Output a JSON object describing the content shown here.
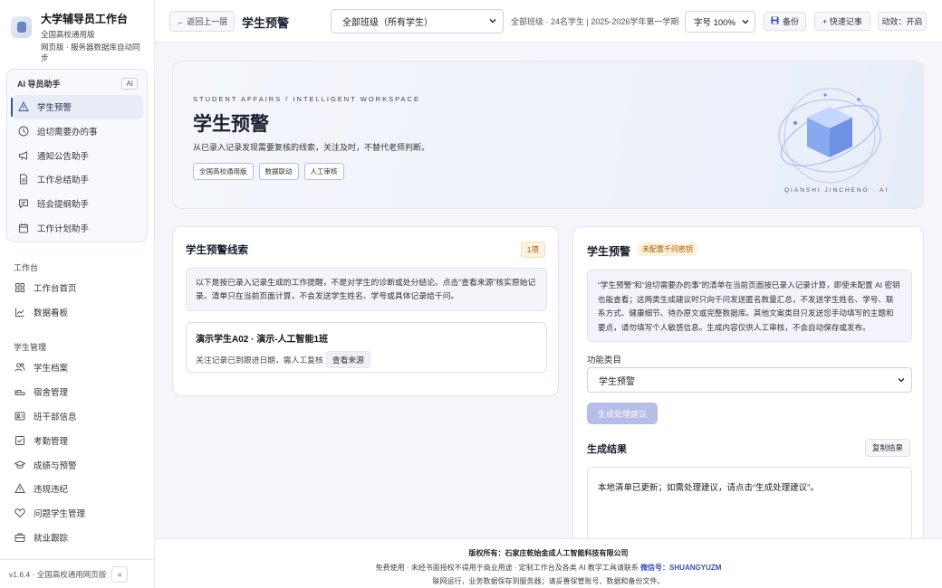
{
  "brand": {
    "title": "大学辅导员工作台",
    "line1": "全国高校通用版",
    "line2": "网页版 · 服务器数据库自动同步"
  },
  "ai_section": {
    "label": "AI 导员助手",
    "badge": "AI",
    "items": [
      {
        "label": "学生预警",
        "icon": "warning-triangle-icon",
        "active": true
      },
      {
        "label": "迫切需要办的事",
        "icon": "clock-icon"
      },
      {
        "label": "通知公告助手",
        "icon": "megaphone-icon"
      },
      {
        "label": "工作总结助手",
        "icon": "document-icon"
      },
      {
        "label": "班会提纲助手",
        "icon": "chat-icon"
      },
      {
        "label": "工作计划助手",
        "icon": "calendar-icon"
      }
    ]
  },
  "workbench_section": {
    "label": "工作台",
    "items": [
      {
        "label": "工作台首页",
        "icon": "grid-icon"
      },
      {
        "label": "数据看板",
        "icon": "line-chart-icon"
      }
    ]
  },
  "student_section": {
    "label": "学生管理",
    "items": [
      {
        "label": "学生档案",
        "icon": "users-icon"
      },
      {
        "label": "宿舍管理",
        "icon": "bed-icon"
      },
      {
        "label": "班干部信息",
        "icon": "id-card-icon"
      },
      {
        "label": "考勤管理",
        "icon": "checkbox-icon"
      },
      {
        "label": "成绩与预警",
        "icon": "graduation-cap-icon"
      },
      {
        "label": "违规违纪",
        "icon": "alert-triangle-icon"
      },
      {
        "label": "问题学生管理",
        "icon": "heart-icon"
      },
      {
        "label": "就业跟踪",
        "icon": "briefcase-icon"
      }
    ]
  },
  "side_footer": {
    "version": "v1.6.4 · 全国高校通用网页版",
    "collapse": "«"
  },
  "topbar": {
    "back_label": "← 返回上一层",
    "page_title": "学生预警",
    "class_select": "全部班级（所有学生）",
    "meta": "全部班级 · 24名学生  |  2025-2026学年第一学期",
    "font_select": "字号 100%",
    "backup_label": "备份",
    "quick_label": "+ 快速记事",
    "motion_label": "动效：开启"
  },
  "hero": {
    "kicker": "STUDENT AFFAIRS / INTELLIGENT WORKSPACE",
    "title": "学生预警",
    "subtitle": "从已录入记录发现需要复核的线索，关注及时，不替代老师判断。",
    "tags": [
      "全国高校通用版",
      "数据联动",
      "人工审核"
    ],
    "orb_caption": "QIANSHI JINCHENG · AI"
  },
  "clues": {
    "title": "学生预警线索",
    "count": "1项",
    "info": "以下是按已录入记录生成的工作提醒，不是对学生的诊断或处分结论。点击“查看来源”核实原始记录。清单只在当前页面计算，不会发送学生姓名、学号或具体记录给千问。",
    "item_name": "演示学生A02 · 演示-人工智能1班",
    "item_desc": "关注记录已到跟进日期，需人工复核",
    "item_button": "查看来源"
  },
  "assistant": {
    "title": "学生预警",
    "badge": "未配置千问密钥",
    "desc": "“学生预警”和“迫切需要办的事”的清单在当前页面按已录入记录计算，即使未配置 AI 密钥也能查看；这两类生成建议时只向千问发送匿名数量汇总，不发送学生姓名、学号、联系方式、健康细节、待办原文或完整数据库。其他文案类目只发送您手动填写的主题和要点，请勿填写个人敏感信息。生成内容仅供人工审核，不会自动保存或发布。",
    "fn_label": "功能类目",
    "fn_value": "学生预警",
    "gen_button": "生成处理建议",
    "result_title": "生成结果",
    "copy_button": "复制结果",
    "result_text": "本地清单已更新；如需处理建议，请点击“生成处理建议”。"
  },
  "footer": {
    "line1": "版权所有：石家庄乾始金成人工智能科技有限公司",
    "line2_pre": "免费使用 · 未经书面授权不得用于商业用途 · 定制工作台及各类 AI 教学工具请联系",
    "line2_wx": "微信号：SHUANGYUZM",
    "line3": "联网运行，业务数据保存到服务器；请妥善保管账号、数据和备份文件。"
  },
  "colors": {
    "accent": "#3e4f8a",
    "button_disabled": "#b6bde8",
    "warn_badge_bg": "#fff1db",
    "wechat_link": "#3b4fb0"
  }
}
